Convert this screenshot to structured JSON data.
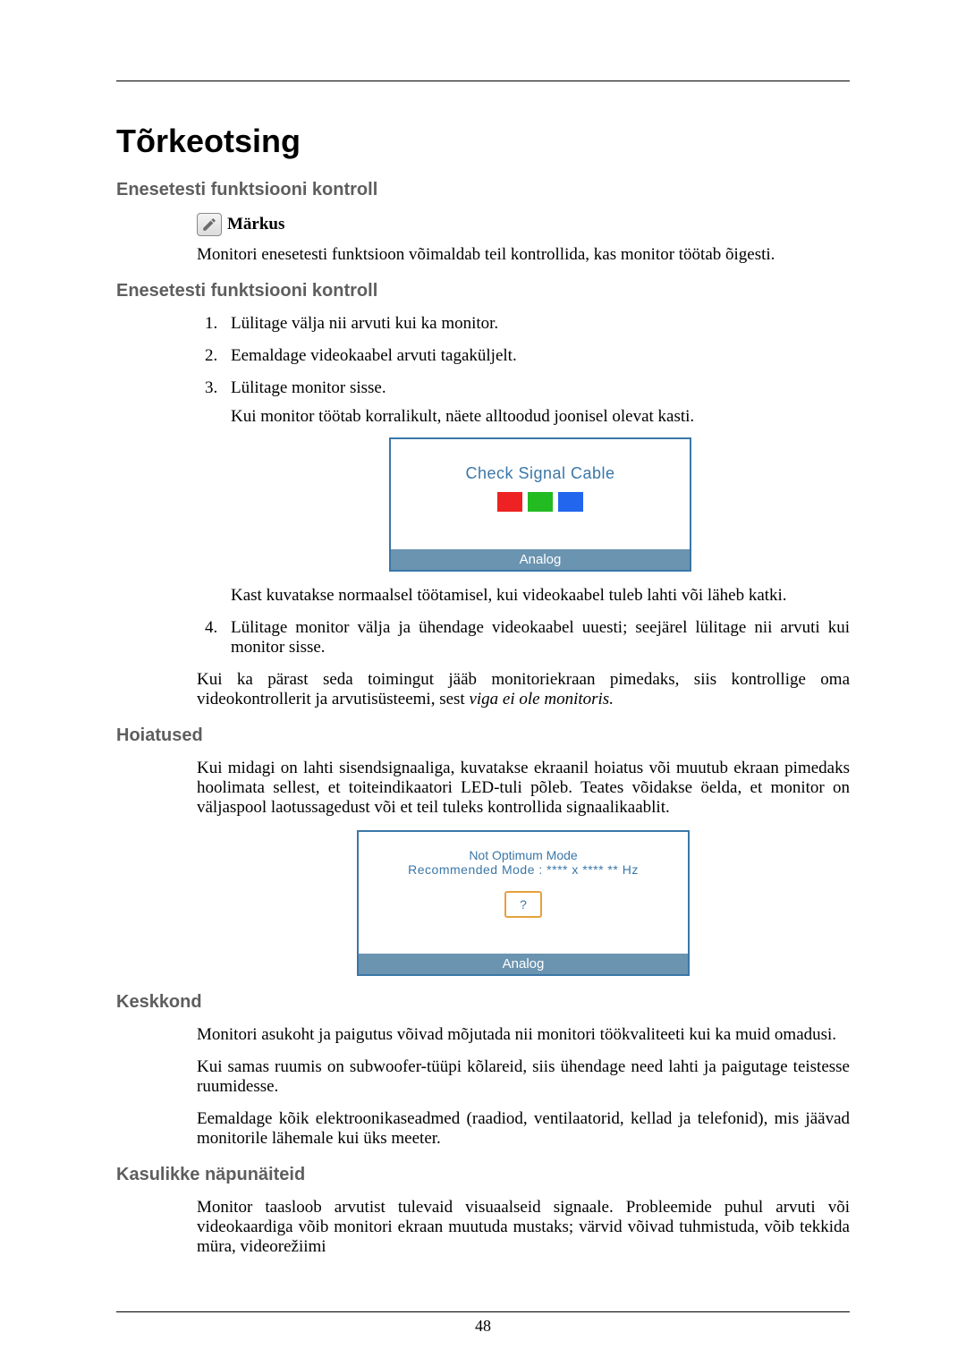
{
  "title": "Tõrkeotsing",
  "sections": {
    "s1": {
      "heading": "Enesetesti funktsiooni kontroll"
    },
    "s2": {
      "heading": "Enesetesti funktsiooni kontroll"
    },
    "s3": {
      "heading": "Hoiatused"
    },
    "s4": {
      "heading": "Keskkond"
    },
    "s5": {
      "heading": "Kasulikke näpunäiteid"
    }
  },
  "note_label": "Märkus",
  "note_text": "Monitori enesetesti funktsioon võimaldab teil kontrollida, kas monitor töötab õigesti.",
  "steps": {
    "i1": "Lülitage välja nii arvuti kui ka monitor.",
    "i2": "Eemaldage videokaabel arvuti tagaküljelt.",
    "i3": "Lülitage monitor sisse.",
    "i3_sub": "Kui monitor töötab korralikult, näete alltoodud joonisel olevat kasti.",
    "i3_after": "Kast kuvatakse normaalsel töötamisel, kui videokaabel tuleb lahti või läheb katki.",
    "i4": "Lülitage monitor välja ja ühendage videokaabel uuesti; seejärel lülitage nii arvuti kui monitor sisse."
  },
  "after_list_1_pre": "Kui ka pärast seda toimingut jääb monitoriekraan pimedaks, siis kontrollige oma videokontrollerit ja arvutisüsteemi, sest ",
  "after_list_1_italic": "viga ei ole monitoris.",
  "fig1": {
    "title": "Check Signal Cable",
    "bar": "Analog"
  },
  "fig2": {
    "line1": "Not Optimum Mode",
    "line2": "Recommended Mode :  **** x ****   ** Hz",
    "bar": "Analog",
    "q": "?"
  },
  "warn_p1": "Kui midagi on lahti sisendsignaaliga, kuvatakse ekraanil hoiatus või muutub ekraan pimedaks hoolimata sellest, et toiteindikaatori LED-tuli põleb. Teates võidakse öelda, et monitor on väljaspool laotussagedust või et teil tuleks kontrollida signaalikaablit.",
  "env_p1": "Monitori asukoht ja paigutus võivad mõjutada nii monitori töökvaliteeti kui ka muid omadusi.",
  "env_p2": "Kui samas ruumis on subwoofer-tüüpi kõlareid, siis ühendage need lahti ja paigutage teistesse ruumidesse.",
  "env_p3": "Eemaldage kõik elektroonikaseadmed (raadiod, ventilaatorid, kellad ja telefonid), mis jäävad monitorile lähemale kui üks meeter.",
  "tips_p1": "Monitor taasloob arvutist tulevaid visuaalseid signaale. Probleemide puhul arvuti või videokaardiga võib monitori ekraan muutuda mustaks; värvid võivad tuhmistuda, võib tekkida müra, videorežiimi",
  "page_number": "48"
}
